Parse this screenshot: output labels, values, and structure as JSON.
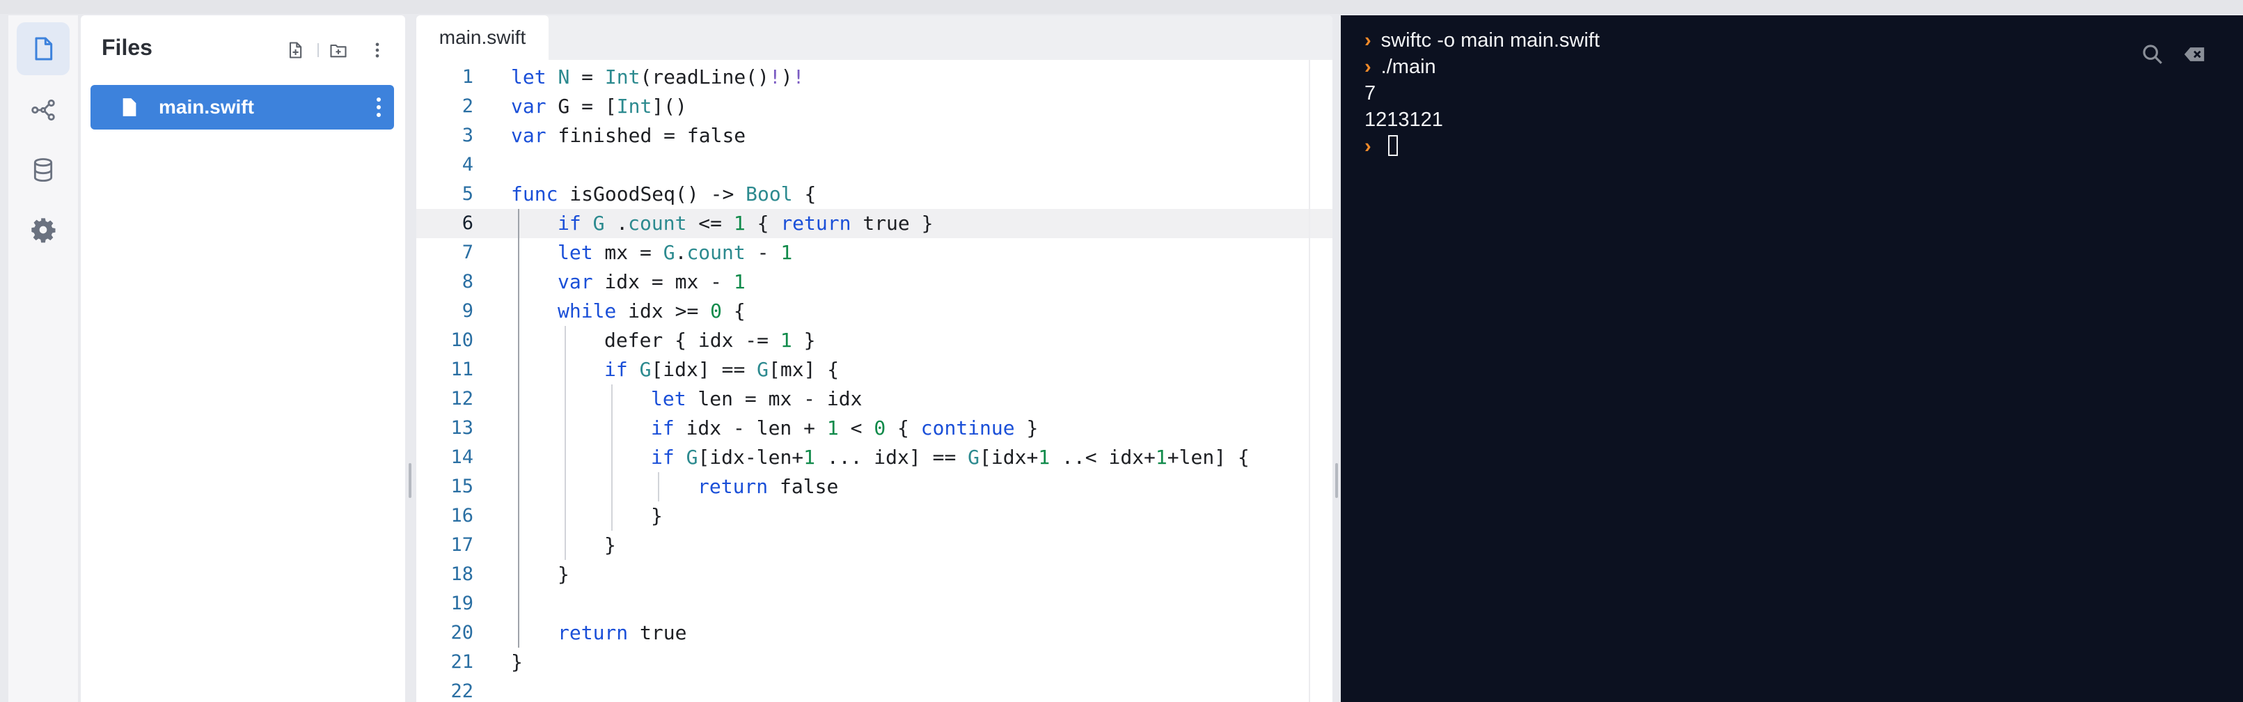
{
  "files_panel": {
    "title": "Files",
    "items": [
      {
        "name": "main.swift"
      }
    ]
  },
  "editor": {
    "tab_label": "main.swift",
    "active_line": 6,
    "lines": [
      {
        "num": "1",
        "indent": 0,
        "tokens": [
          [
            "k",
            "let"
          ],
          [
            "",
            "",
            " "
          ],
          [
            "t",
            "N"
          ],
          [
            "",
            " = "
          ],
          [
            "t",
            "Int"
          ],
          [
            "",
            "(readLine()"
          ],
          [
            "o",
            "!"
          ],
          [
            "",
            ")"
          ],
          [
            "o",
            "!"
          ]
        ]
      },
      {
        "num": "2",
        "indent": 0,
        "tokens": [
          [
            "k",
            "var"
          ],
          [
            "",
            " G = ["
          ],
          [
            "t",
            "Int"
          ],
          [
            "",
            "]()"
          ]
        ]
      },
      {
        "num": "3",
        "indent": 0,
        "tokens": [
          [
            "k",
            "var"
          ],
          [
            "",
            " finished = false"
          ]
        ]
      },
      {
        "num": "4",
        "indent": 0,
        "tokens": []
      },
      {
        "num": "5",
        "indent": 0,
        "tokens": [
          [
            "k",
            "func"
          ],
          [
            "",
            " isGoodSeq() -> "
          ],
          [
            "t",
            "Bool"
          ],
          [
            "",
            " {"
          ]
        ]
      },
      {
        "num": "6",
        "indent": 1,
        "tokens": [
          [
            "k",
            "if"
          ],
          [
            "",
            " "
          ],
          [
            "t",
            "G"
          ],
          [
            "",
            " ."
          ],
          [
            "t",
            "count"
          ],
          [
            "",
            " <= "
          ],
          [
            "n",
            "1"
          ],
          [
            "",
            " { "
          ],
          [
            "k",
            "return"
          ],
          [
            "",
            " true }"
          ]
        ]
      },
      {
        "num": "7",
        "indent": 1,
        "tokens": [
          [
            "k",
            "let"
          ],
          [
            "",
            " mx = "
          ],
          [
            "t",
            "G"
          ],
          [
            "",
            "."
          ],
          [
            "t",
            "count"
          ],
          [
            "",
            " - "
          ],
          [
            "n",
            "1"
          ]
        ]
      },
      {
        "num": "8",
        "indent": 1,
        "tokens": [
          [
            "k",
            "var"
          ],
          [
            "",
            " idx = mx - "
          ],
          [
            "n",
            "1"
          ]
        ]
      },
      {
        "num": "9",
        "indent": 1,
        "tokens": [
          [
            "k",
            "while"
          ],
          [
            "",
            " idx >= "
          ],
          [
            "n",
            "0"
          ],
          [
            "",
            " {"
          ]
        ]
      },
      {
        "num": "10",
        "indent": 2,
        "tokens": [
          [
            "",
            "defer { idx -= "
          ],
          [
            "n",
            "1"
          ],
          [
            "",
            " }"
          ]
        ]
      },
      {
        "num": "11",
        "indent": 2,
        "tokens": [
          [
            "k",
            "if"
          ],
          [
            "",
            " "
          ],
          [
            "t",
            "G"
          ],
          [
            "",
            "[idx] == "
          ],
          [
            "t",
            "G"
          ],
          [
            "",
            "[mx] {"
          ]
        ]
      },
      {
        "num": "12",
        "indent": 3,
        "tokens": [
          [
            "k",
            "let"
          ],
          [
            "",
            " len = mx - idx"
          ]
        ]
      },
      {
        "num": "13",
        "indent": 3,
        "tokens": [
          [
            "k",
            "if"
          ],
          [
            "",
            " idx - len + "
          ],
          [
            "n",
            "1"
          ],
          [
            "",
            " < "
          ],
          [
            "n",
            "0"
          ],
          [
            "",
            " { "
          ],
          [
            "k",
            "continue"
          ],
          [
            "",
            " }"
          ]
        ]
      },
      {
        "num": "14",
        "indent": 3,
        "tokens": [
          [
            "k",
            "if"
          ],
          [
            "",
            " "
          ],
          [
            "t",
            "G"
          ],
          [
            "",
            "[idx-len+"
          ],
          [
            "n",
            "1"
          ],
          [
            "",
            " ... idx] == "
          ],
          [
            "t",
            "G"
          ],
          [
            "",
            "[idx+"
          ],
          [
            "n",
            "1"
          ],
          [
            "",
            " ..< idx+"
          ],
          [
            "n",
            "1"
          ],
          [
            "",
            "+len] {"
          ]
        ]
      },
      {
        "num": "15",
        "indent": 4,
        "tokens": [
          [
            "k",
            "return"
          ],
          [
            "",
            " false"
          ]
        ]
      },
      {
        "num": "16",
        "indent": 3,
        "tokens": [
          [
            "",
            "}"
          ]
        ]
      },
      {
        "num": "17",
        "indent": 2,
        "tokens": [
          [
            "",
            "}"
          ]
        ]
      },
      {
        "num": "18",
        "indent": 1,
        "tokens": [
          [
            "",
            "}"
          ]
        ]
      },
      {
        "num": "19",
        "indent": 1,
        "tokens": []
      },
      {
        "num": "20",
        "indent": 1,
        "tokens": [
          [
            "k",
            "return"
          ],
          [
            "",
            " true"
          ]
        ]
      },
      {
        "num": "21",
        "indent": 0,
        "tokens": [
          [
            "",
            "}"
          ]
        ]
      },
      {
        "num": "22",
        "indent": 0,
        "tokens": []
      }
    ]
  },
  "terminal": {
    "lines": [
      {
        "prompt": true,
        "text": "swiftc -o main main.swift"
      },
      {
        "prompt": true,
        "text": "./main"
      },
      {
        "prompt": false,
        "text": "7"
      },
      {
        "prompt": false,
        "text": "1213121"
      },
      {
        "prompt": true,
        "text": ""
      }
    ]
  },
  "colors": {
    "accent": "#3d82dc",
    "terminal_bg": "#0c1120",
    "prompt": "#f08a2a"
  },
  "icons": [
    "file-icon",
    "graph-icon",
    "database-icon",
    "gear-icon",
    "new-file-icon",
    "new-folder-icon",
    "more-icon",
    "search-icon",
    "clear-icon"
  ]
}
